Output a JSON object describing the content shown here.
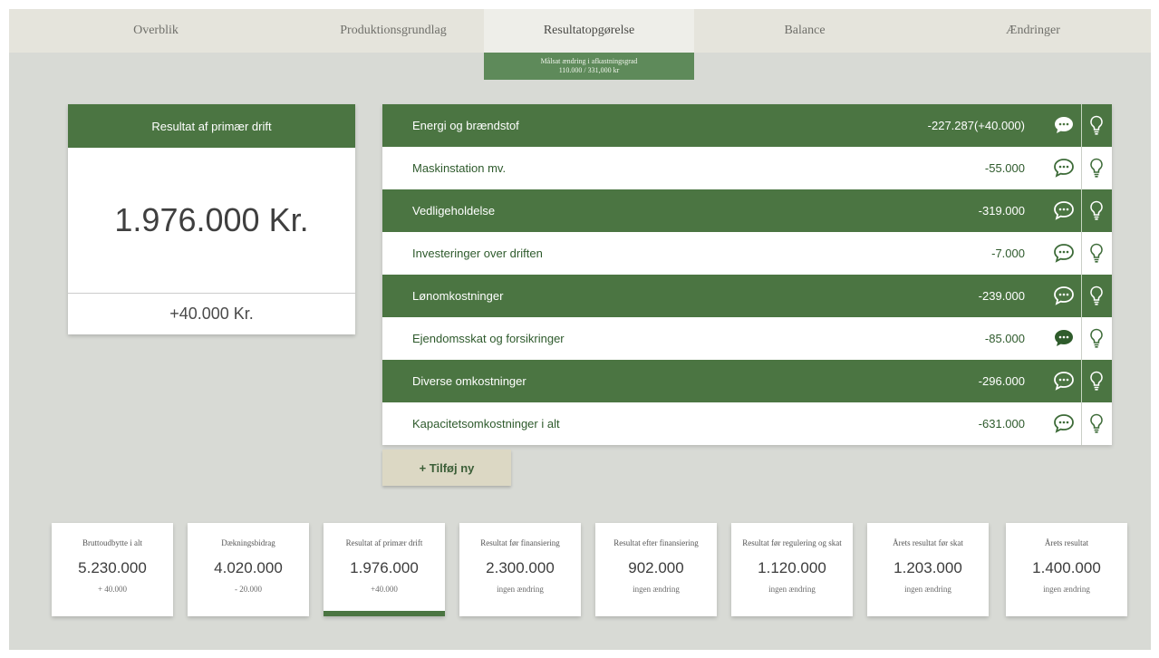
{
  "colors": {
    "accent": "#4b7542",
    "background": "#d8dad5",
    "tab_bar": "#e5e4dc",
    "banner": "#5e8a5a",
    "add_button": "#dcd8c4"
  },
  "tabs": [
    {
      "label": "Overblik",
      "active": false
    },
    {
      "label": "Produktionsgrundlag",
      "active": false
    },
    {
      "label": "Resultatopgørelse",
      "active": true
    },
    {
      "label": "Balance",
      "active": false
    },
    {
      "label": "Ændringer",
      "active": false
    }
  ],
  "banner": {
    "line1": "Målsat ændring i afkastningsgrad",
    "line2": "110.000 / 331,000 kr"
  },
  "result_card": {
    "title": "Resultat af primær drift",
    "value": "1.976.000 Kr.",
    "change": "+40.000 Kr."
  },
  "cost_rows": [
    {
      "label": "Energi og brændstof",
      "amount": "-227.287(+40.000)",
      "style": "dark",
      "comment_icon": "comment-filled-icon",
      "bulb_icon": "lightbulb-icon"
    },
    {
      "label": "Maskinstation mv.",
      "amount": "-55.000",
      "style": "light",
      "comment_icon": "comment-outline-icon",
      "bulb_icon": "lightbulb-icon"
    },
    {
      "label": "Vedligeholdelse",
      "amount": "-319.000",
      "style": "dark",
      "comment_icon": "comment-outline-icon",
      "bulb_icon": "lightbulb-icon"
    },
    {
      "label": "Investeringer over driften",
      "amount": "-7.000",
      "style": "light",
      "comment_icon": "comment-outline-icon",
      "bulb_icon": "lightbulb-icon"
    },
    {
      "label": "Lønomkostninger",
      "amount": "-239.000",
      "style": "dark",
      "comment_icon": "comment-outline-icon",
      "bulb_icon": "lightbulb-icon"
    },
    {
      "label": "Ejendomsskat og forsikringer",
      "amount": "-85.000",
      "style": "light",
      "comment_icon": "comment-filled-icon",
      "bulb_icon": "lightbulb-icon"
    },
    {
      "label": "Diverse omkostninger",
      "amount": "-296.000",
      "style": "dark",
      "comment_icon": "comment-outline-icon",
      "bulb_icon": "lightbulb-icon"
    },
    {
      "label": "Kapacitetsomkostninger i alt",
      "amount": "-631.000",
      "style": "light",
      "comment_icon": "comment-outline-icon",
      "bulb_icon": "lightbulb-icon"
    }
  ],
  "add_button": {
    "label": "+ Tilføj ny"
  },
  "kpis": [
    {
      "label": "Bruttoudbytte i alt",
      "value": "5.230.000",
      "sub": "+ 40.000",
      "selected": false
    },
    {
      "label": "Dækningsbidrag",
      "value": "4.020.000",
      "sub": "- 20.000",
      "selected": false
    },
    {
      "label": "Resultat af primær drift",
      "value": "1.976.000",
      "sub": "+40.000",
      "selected": true
    },
    {
      "label": "Resultat før finansiering",
      "value": "2.300.000",
      "sub": "ingen ændring",
      "selected": false
    },
    {
      "label": "Resultat efter finansiering",
      "value": "902.000",
      "sub": "ingen ændring",
      "selected": false
    },
    {
      "label": "Resultat før regulering og skat",
      "value": "1.120.000",
      "sub": "ingen ændring",
      "selected": false
    },
    {
      "label": "Årets resultat før skat",
      "value": "1.203.000",
      "sub": "ingen ændring",
      "selected": false
    },
    {
      "label": "Årets resultat",
      "value": "1.400.000",
      "sub": "ingen ændring",
      "selected": false
    }
  ]
}
